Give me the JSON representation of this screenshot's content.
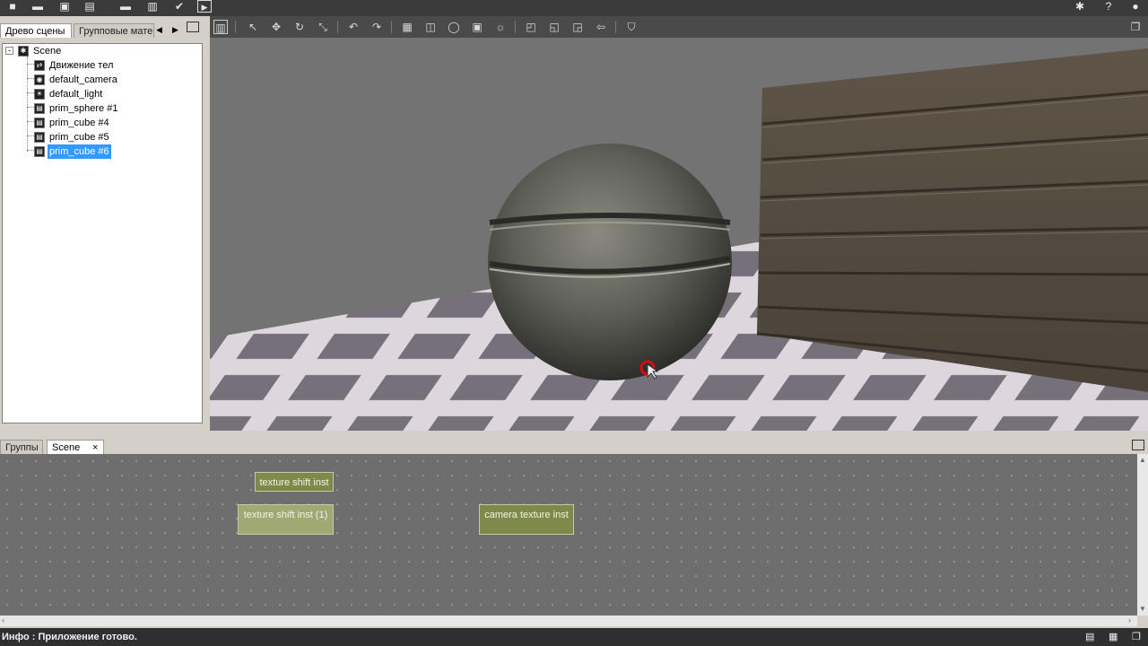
{
  "left_panel": {
    "tabs": [
      {
        "label": "Древо сцены"
      },
      {
        "label": "Групповые мате"
      }
    ],
    "tree": {
      "root": "Scene",
      "items": [
        {
          "label": "Движение тел",
          "icon": "motion-icon"
        },
        {
          "label": "default_camera",
          "icon": "camera-icon"
        },
        {
          "label": "default_light",
          "icon": "light-icon"
        },
        {
          "label": "prim_sphere #1",
          "icon": "mesh-icon"
        },
        {
          "label": "prim_cube #4",
          "icon": "mesh-icon"
        },
        {
          "label": "prim_cube #5",
          "icon": "mesh-icon"
        },
        {
          "label": "prim_cube #6",
          "icon": "mesh-icon",
          "selected": true
        }
      ]
    }
  },
  "bottom_panel": {
    "tabs": [
      {
        "label": "Группы"
      },
      {
        "label": "Scene",
        "closable": true,
        "close": "×"
      }
    ],
    "nodes": [
      {
        "label": "texture shift inst",
        "color": "#7d8a4a"
      },
      {
        "label": "texture shift inst (1)",
        "color": "#a0a874"
      },
      {
        "label": "camera texture inst",
        "color": "#7d8a4a"
      }
    ]
  },
  "status": {
    "text": "Инфо : Приложение готово."
  },
  "colors": {
    "toolbar_bg": "#3b3b3b",
    "viewport_bg": "#737373",
    "selection": "#3399ff",
    "node_olive": "#7d8a4a",
    "node_olive_light": "#a0a874"
  }
}
